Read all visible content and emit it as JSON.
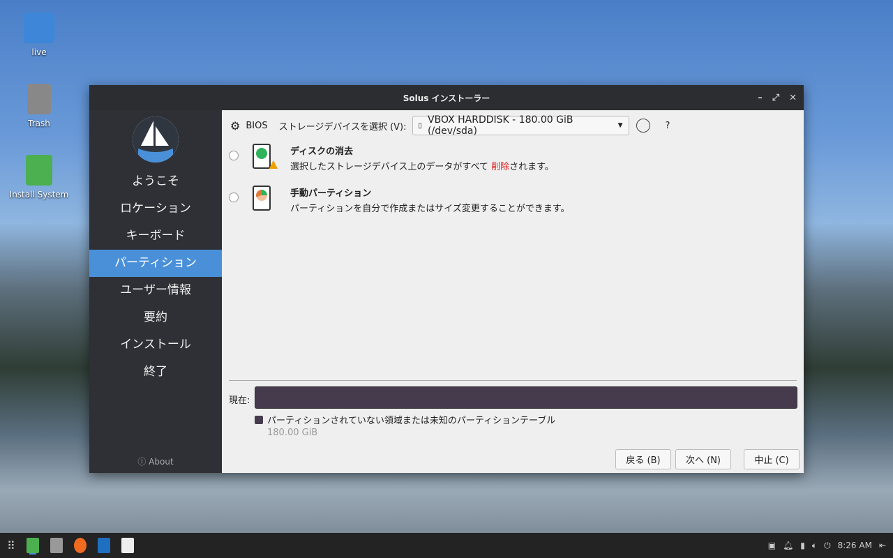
{
  "desktop": {
    "icons": [
      {
        "label": "live"
      },
      {
        "label": "Trash"
      },
      {
        "label": "Install System"
      }
    ]
  },
  "window": {
    "title": "Solus インストーラー",
    "controls": {
      "minimize": "–",
      "maximize": "⤢",
      "close": "✕"
    }
  },
  "sidebar": {
    "items": [
      {
        "label": "ようこそ"
      },
      {
        "label": "ロケーション"
      },
      {
        "label": "キーボード"
      },
      {
        "label": "パーティション",
        "selected": true
      },
      {
        "label": "ユーザー情報"
      },
      {
        "label": "要約"
      },
      {
        "label": "インストール"
      },
      {
        "label": "終了"
      }
    ],
    "about": "About"
  },
  "main": {
    "boot_mode": "BIOS",
    "storage_label": "ストレージデバイスを選択 (V):",
    "storage_value": "VBOX HARDDISK - 180.00 GiB (/dev/sda)",
    "help": "?",
    "options": [
      {
        "title": "ディスクの消去",
        "desc_before": "選択したストレージデバイス上のデータがすべて ",
        "desc_highlight": "削除",
        "desc_after": "されます。"
      },
      {
        "title": "手動パーティション",
        "desc": "パーティションを自分で作成またはサイズ変更することができます。"
      }
    ],
    "current_label": "現在:",
    "legend_label": "パーティションされていない領域または未知のパーティションテーブル",
    "legend_size": "180.00 GiB",
    "buttons": {
      "back": "戻る (B)",
      "next": "次へ (N)",
      "cancel": "中止 (C)"
    }
  },
  "colors": {
    "accent": "#4a90d9",
    "danger": "#e02020",
    "partition": "#463b4d"
  },
  "taskbar": {
    "clock": "8:26 AM"
  }
}
